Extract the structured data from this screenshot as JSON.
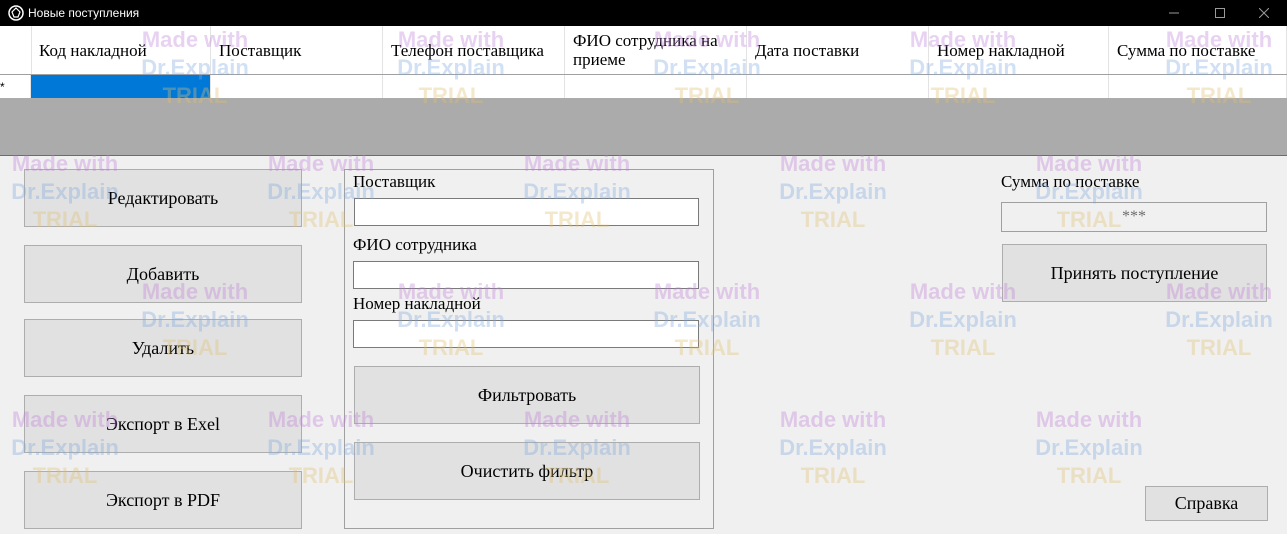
{
  "window": {
    "title": "Новые поступления",
    "controls": [
      "minimize-icon",
      "maximize-icon",
      "close-icon"
    ]
  },
  "grid": {
    "columns": [
      {
        "label": "Код накладной"
      },
      {
        "label": "Поставщик"
      },
      {
        "label": "Телефон поставщика"
      },
      {
        "label": "ФИО сотрудника на приеме"
      },
      {
        "label": "Дата поставки"
      },
      {
        "label": "Номер накладной"
      },
      {
        "label": "Сумма по поставке"
      }
    ],
    "new_row_marker": "*"
  },
  "actions": {
    "edit": "Редактировать",
    "add": "Добавить",
    "delete": "Удалить",
    "export_excel": "Экспорт в Exel",
    "export_pdf": "Экспорт в PDF"
  },
  "filter": {
    "supplier_label": "Поставщик",
    "supplier_value": "",
    "employee_label": "ФИО сотрудника",
    "employee_value": "",
    "invoice_label": "Номер накладной",
    "invoice_value": "",
    "apply": "Фильтровать",
    "clear": "Очистить фильтр"
  },
  "summary": {
    "sum_label": "Сумма по поставке",
    "sum_value": "***",
    "accept": "Принять поступление"
  },
  "help": "Справка",
  "watermark": {
    "line1": "Made with",
    "line2": "Dr.Explain",
    "line3": "TRIAL"
  },
  "colors": {
    "selection": "#0078d7",
    "titlebar": "#000000",
    "button_face": "#e1e1e1",
    "grid_background": "#ababab"
  }
}
